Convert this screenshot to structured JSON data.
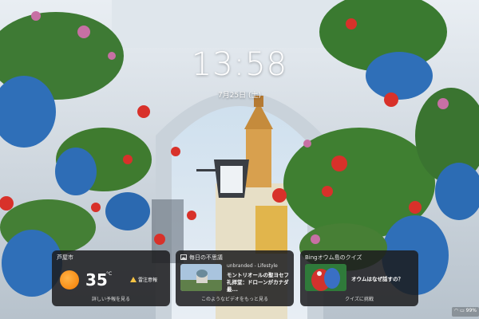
{
  "lock": {
    "time": "13:58",
    "date": "7月25日 (土)"
  },
  "weather": {
    "location": "芦屋市",
    "temperature": "35",
    "unit": "°C",
    "alert": "雷注意報",
    "footer": "詳しい予報を見る",
    "icon": "sun-icon",
    "accent": "#f57c00"
  },
  "news": {
    "header": "毎日の不思議",
    "source": "unbranded - Lifestyle",
    "title": "モントリオールの聖ヨセフ礼拝堂：ドローンがカナダ最...",
    "footer": "このようなビデオをもっと見る",
    "icon": "image-icon"
  },
  "quiz": {
    "header": "Bingオウム島のクイズ",
    "question": "オウムはなぜ話すの？",
    "footer": "クイズに挑戦",
    "icon": "quiz-icon"
  },
  "tray": {
    "battery": "99%",
    "icons": [
      "wifi-icon",
      "battery-icon"
    ]
  }
}
